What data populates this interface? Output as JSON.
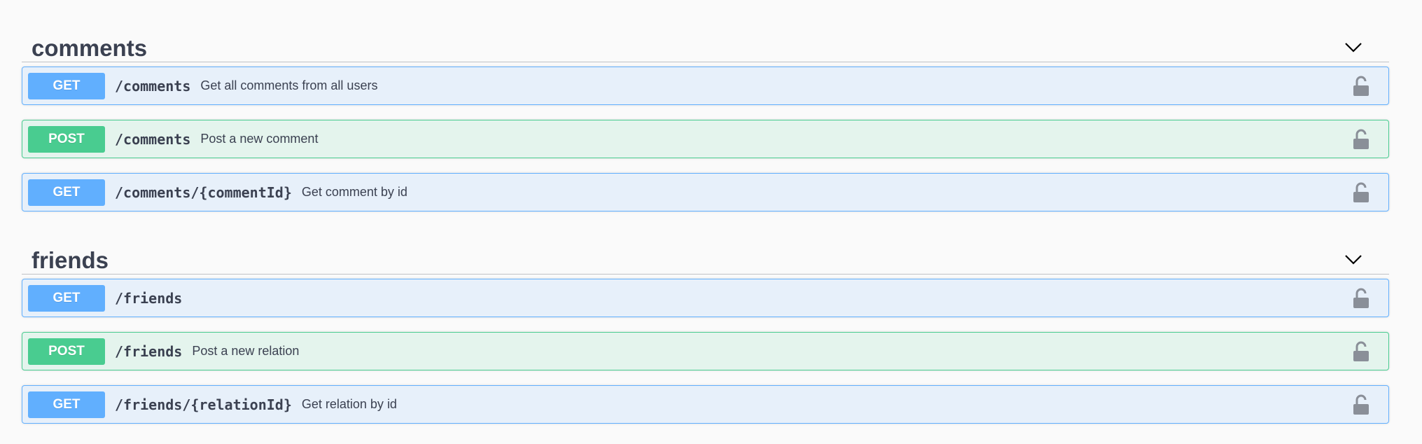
{
  "sections": [
    {
      "title": "comments",
      "operations": [
        {
          "method": "GET",
          "path": "/comments",
          "summary": "Get all comments from all users"
        },
        {
          "method": "POST",
          "path": "/comments",
          "summary": "Post a new comment"
        },
        {
          "method": "GET",
          "path": "/comments/{commentId}",
          "summary": "Get comment by id"
        }
      ]
    },
    {
      "title": "friends",
      "operations": [
        {
          "method": "GET",
          "path": "/friends",
          "summary": ""
        },
        {
          "method": "POST",
          "path": "/friends",
          "summary": "Post a new relation"
        },
        {
          "method": "GET",
          "path": "/friends/{relationId}",
          "summary": "Get relation by id"
        }
      ]
    }
  ],
  "icons": {
    "collapse": "chevron-down-icon",
    "authorize": "unlocked-icon"
  },
  "colors": {
    "get": "#61affe",
    "post": "#49cc90",
    "text": "#3b4151"
  }
}
